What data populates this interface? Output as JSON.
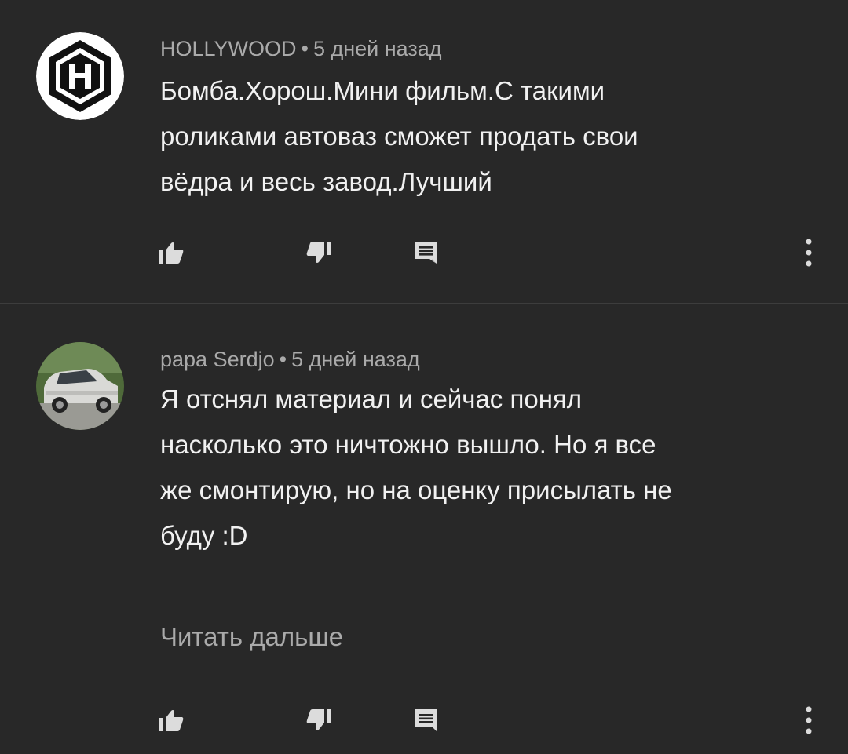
{
  "colors": {
    "background": "#282828",
    "text_primary": "#f1f1f1",
    "text_secondary": "#aaaaaa",
    "divider": "#3d3d3d",
    "icon": "#dcdcdc"
  },
  "comments": [
    {
      "author": "HOLLYWOOD",
      "separator": "•",
      "time": "5 дней назад",
      "text": "Бомба.Хорош.Мини фильм.С такими\nроликами автоваз сможет продать свои\nвёдра и весь завод.Лучший",
      "avatar_icon": "hollywood-logo-avatar",
      "actions": [
        "like-icon",
        "dislike-icon",
        "reply-icon",
        "more-vert-icon"
      ]
    },
    {
      "author": "papa Serdjo",
      "separator": "•",
      "time": "5 дней назад",
      "text": "Я отснял материал и сейчас понял\nнасколько это ничтожно вышло. Но я все\nже смонтирую, но на оценку присылать не\nбуду :D",
      "read_more": "Читать дальше",
      "avatar_icon": "car-photo-avatar",
      "actions": [
        "like-icon",
        "dislike-icon",
        "reply-icon",
        "more-vert-icon"
      ]
    }
  ]
}
